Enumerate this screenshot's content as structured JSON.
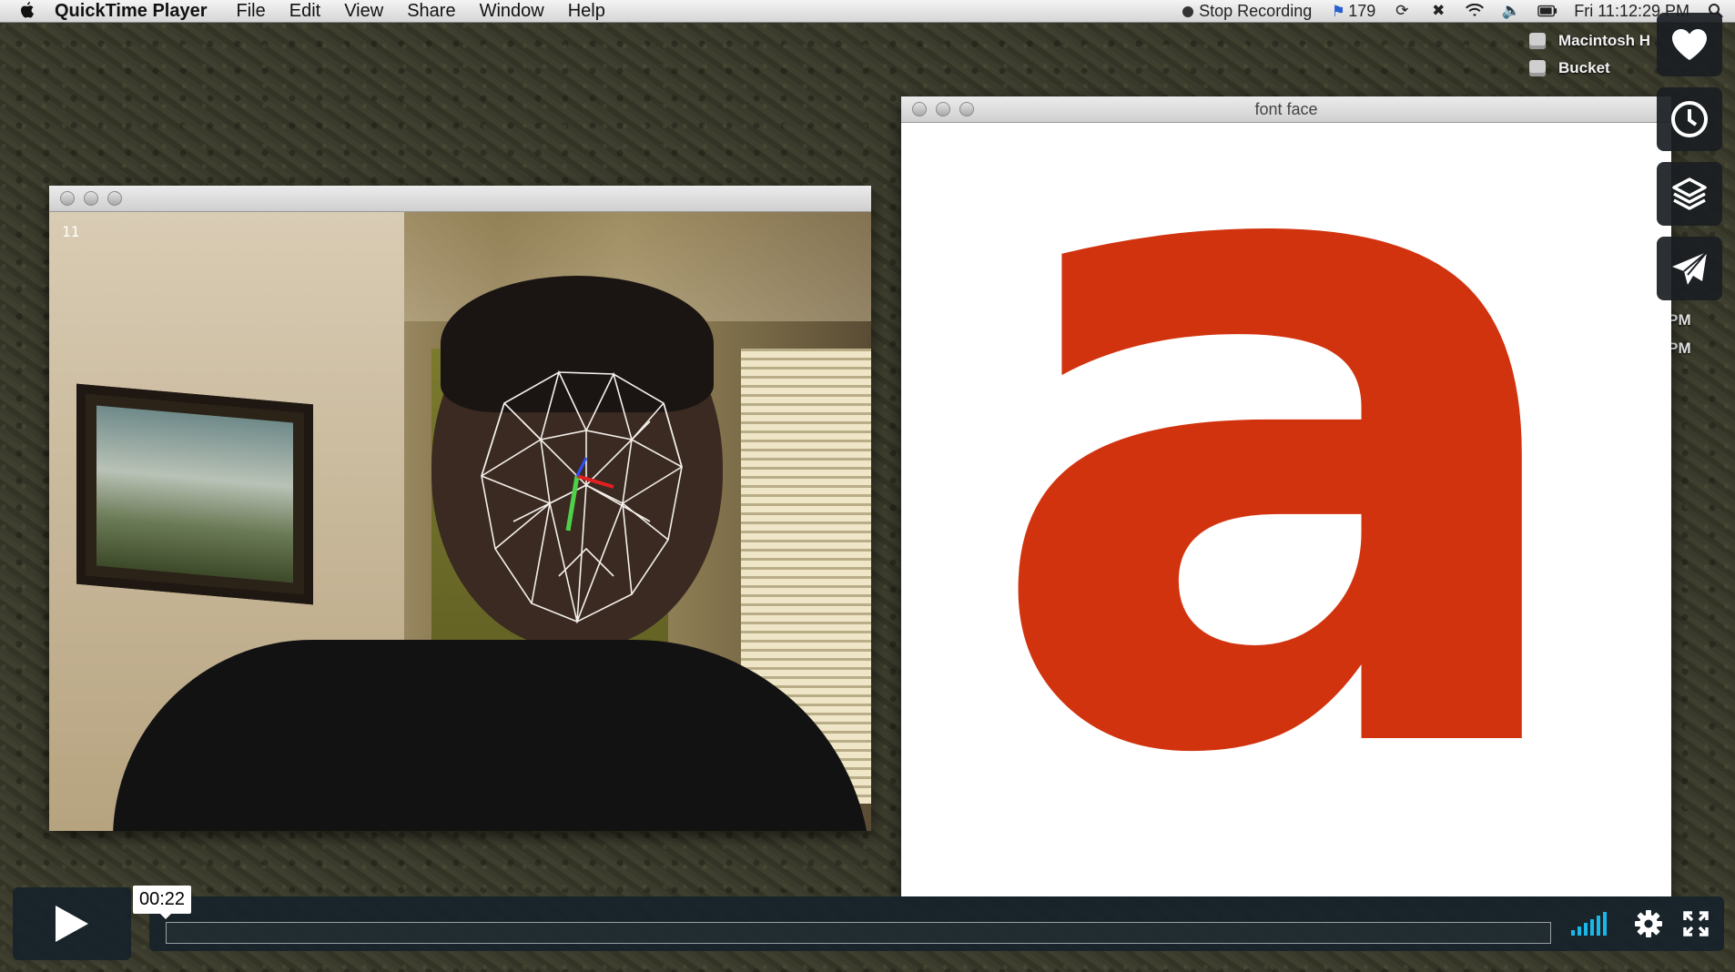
{
  "menubar": {
    "app_name": "QuickTime Player",
    "items": [
      "File",
      "Edit",
      "View",
      "Share",
      "Window",
      "Help"
    ],
    "stop_recording": "Stop Recording",
    "counter": "179",
    "clock": "Fri 11:12:29 PM"
  },
  "desktop": {
    "drives": [
      "Macintosh H",
      "Bucket"
    ],
    "times": [
      "1 PM",
      "0 PM"
    ]
  },
  "camera_window": {
    "frame_count": "11"
  },
  "font_window": {
    "title": "font face",
    "glyph": "a",
    "glyph_color": "#d2330f"
  },
  "player": {
    "current_time": "00:22",
    "progress": 0.0,
    "accent": "#1ab7ea"
  },
  "side_actions": [
    "heart-icon",
    "clock-icon",
    "layers-icon",
    "send-icon"
  ]
}
